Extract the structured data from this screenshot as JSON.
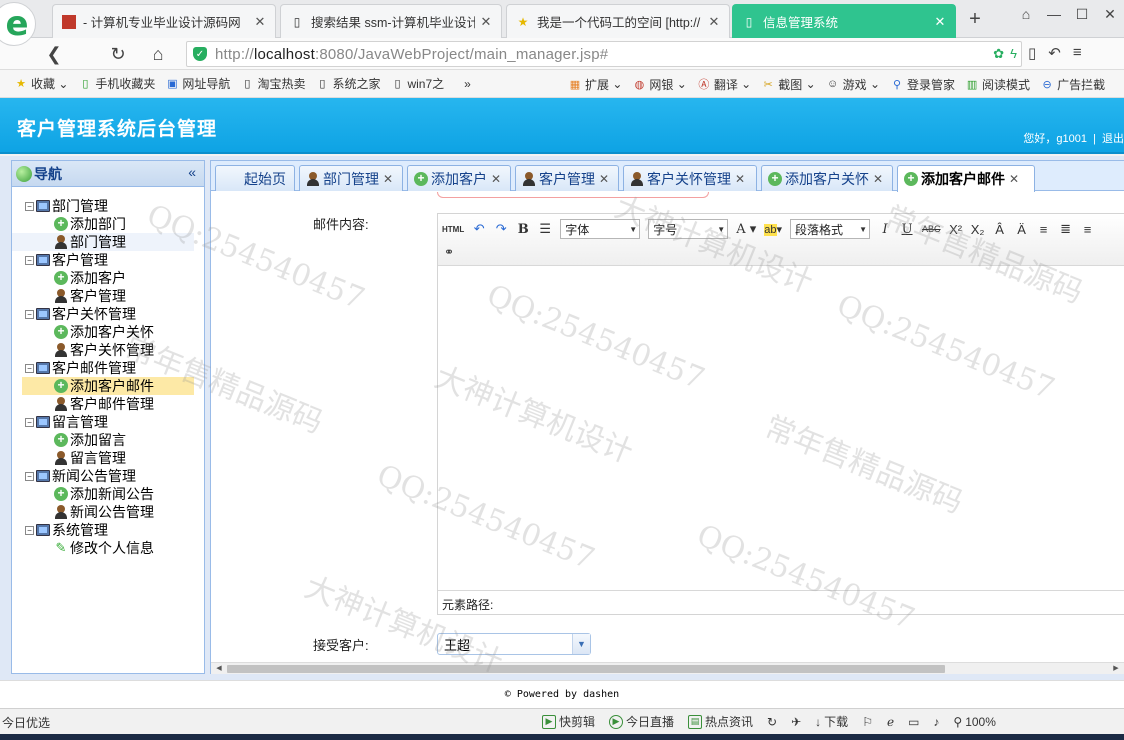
{
  "browser": {
    "logo": "e",
    "tabs": [
      {
        "title": "- 计算机专业毕业设计源码网",
        "icon": "red-square-icon"
      },
      {
        "title": "搜索结果 ssm-计算机毕业设计",
        "icon": "page-icon"
      },
      {
        "title": "我是一个代码工的空间 [http://",
        "icon": "star-face-icon"
      },
      {
        "title": "信息管理系统",
        "icon": "page-icon",
        "active": true
      }
    ],
    "new_tab": "+",
    "url_prefix": "http://",
    "url_host": "localhost",
    "url_rest": ":8080/JavaWebProject/main_manager.jsp#"
  },
  "bookmarks": {
    "left": [
      {
        "label": "收藏",
        "icon": "star-icon"
      },
      {
        "label": "手机收藏夹",
        "icon": "phone-icon"
      },
      {
        "label": "网址导航",
        "icon": "nav-icon"
      },
      {
        "label": "淘宝热卖",
        "icon": "page-icon"
      },
      {
        "label": "系统之家",
        "icon": "page-icon"
      },
      {
        "label": "win7之",
        "icon": "page-icon"
      }
    ],
    "more": "»",
    "right": [
      {
        "label": "扩展",
        "icon": "grid-icon"
      },
      {
        "label": "网银",
        "icon": "bank-icon"
      },
      {
        "label": "翻译",
        "icon": "translate-icon"
      },
      {
        "label": "截图",
        "icon": "scissors-icon"
      },
      {
        "label": "游戏",
        "icon": "gamepad-icon"
      },
      {
        "label": "登录管家",
        "icon": "key-icon"
      },
      {
        "label": "阅读模式",
        "icon": "book-icon"
      },
      {
        "label": "广告拦截",
        "icon": "block-icon"
      }
    ]
  },
  "header": {
    "title": "客户管理系统后台管理",
    "greeting": "您好，",
    "username": "g1001",
    "separator": "|",
    "logout": "退出"
  },
  "sidebar": {
    "title": "导航",
    "collapse": "«",
    "groups": [
      {
        "label": "部门管理",
        "items": [
          {
            "label": "添加部门",
            "type": "add"
          },
          {
            "label": "部门管理",
            "type": "user",
            "hl": true
          }
        ]
      },
      {
        "label": "客户管理",
        "items": [
          {
            "label": "添加客户",
            "type": "add"
          },
          {
            "label": "客户管理",
            "type": "user"
          }
        ]
      },
      {
        "label": "客户关怀管理",
        "items": [
          {
            "label": "添加客户关怀",
            "type": "add"
          },
          {
            "label": "客户关怀管理",
            "type": "user"
          }
        ]
      },
      {
        "label": "客户邮件管理",
        "items": [
          {
            "label": "添加客户邮件",
            "type": "add",
            "selected": true
          },
          {
            "label": "客户邮件管理",
            "type": "user"
          }
        ]
      },
      {
        "label": "留言管理",
        "items": [
          {
            "label": "添加留言",
            "type": "add"
          },
          {
            "label": "留言管理",
            "type": "user"
          }
        ]
      },
      {
        "label": "新闻公告管理",
        "items": [
          {
            "label": "添加新闻公告",
            "type": "add"
          },
          {
            "label": "新闻公告管理",
            "type": "user"
          }
        ]
      },
      {
        "label": "系统管理",
        "items": [
          {
            "label": "修改个人信息",
            "type": "pen"
          }
        ]
      }
    ]
  },
  "tabs": [
    {
      "label": "起始页",
      "icon": "none",
      "closable": false
    },
    {
      "label": "部门管理",
      "icon": "user",
      "closable": true
    },
    {
      "label": "添加客户",
      "icon": "add",
      "closable": true
    },
    {
      "label": "客户管理",
      "icon": "user",
      "closable": true
    },
    {
      "label": "客户关怀管理",
      "icon": "user",
      "closable": true
    },
    {
      "label": "添加客户关怀",
      "icon": "add",
      "closable": true
    },
    {
      "label": "添加客户邮件",
      "icon": "add",
      "closable": true,
      "active": true
    }
  ],
  "form": {
    "content_label": "邮件内容:",
    "editor": {
      "html_btn": "HTML",
      "font_select": "字体",
      "size_select": "字号",
      "paragraph_select": "段落格式",
      "element_path_label": "元素路径:"
    },
    "receiver_label": "接受客户:",
    "receiver_value": "王超"
  },
  "footer": {
    "text": "© Powered by dashen"
  },
  "statusbar": {
    "left": "今日优选",
    "items": [
      {
        "label": "快剪辑",
        "icon": "play-icon"
      },
      {
        "label": "今日直播",
        "icon": "live-icon"
      },
      {
        "label": "热点资讯",
        "icon": "news-icon"
      },
      {
        "label": "",
        "icon": "refresh-icon"
      },
      {
        "label": "",
        "icon": "plane-icon"
      },
      {
        "label": "下载",
        "icon": "download-icon"
      },
      {
        "label": "",
        "icon": "flag-icon"
      },
      {
        "label": "",
        "icon": "ie-icon"
      },
      {
        "label": "",
        "icon": "window-icon"
      },
      {
        "label": "",
        "icon": "sound-icon"
      },
      {
        "label": "100%",
        "icon": "zoom-icon"
      }
    ]
  },
  "watermarks": [
    "QQ:254540457",
    "常年售精品源码",
    "大神计算机设计"
  ]
}
